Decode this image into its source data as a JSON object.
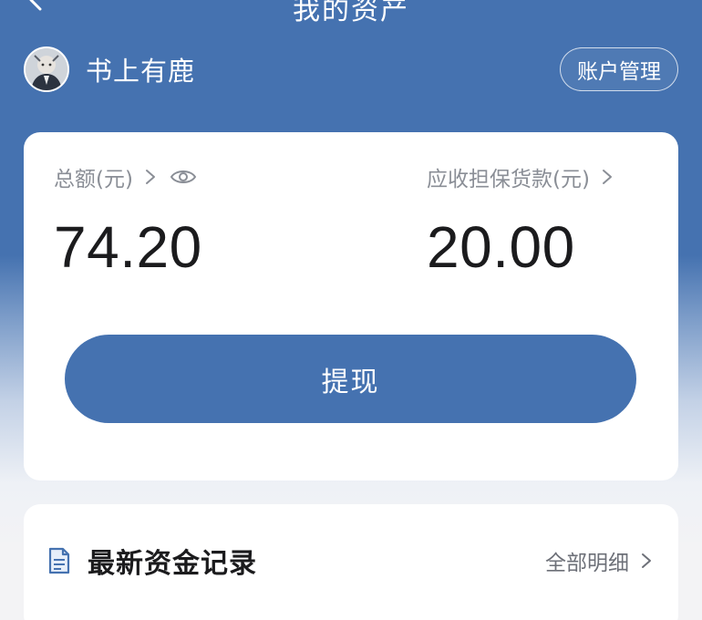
{
  "nav": {
    "title": "我的资产"
  },
  "user": {
    "name": "书上有鹿",
    "account_button": "账户管理"
  },
  "balance": {
    "total_label": "总额(元)",
    "total_value": "74.20",
    "guarantee_label": "应收担保货款(元)",
    "guarantee_value": "20.00",
    "withdraw_label": "提现"
  },
  "records": {
    "title": "最新资金记录",
    "all_label": "全部明细"
  },
  "colors": {
    "primary": "#4572b0",
    "card": "#ffffff",
    "text_dark": "#1b1b1d",
    "text_muted": "#8a8e96"
  },
  "icons": [
    "back-arrow-icon",
    "avatar",
    "chevron-right-icon",
    "eye-icon",
    "document-icon"
  ]
}
